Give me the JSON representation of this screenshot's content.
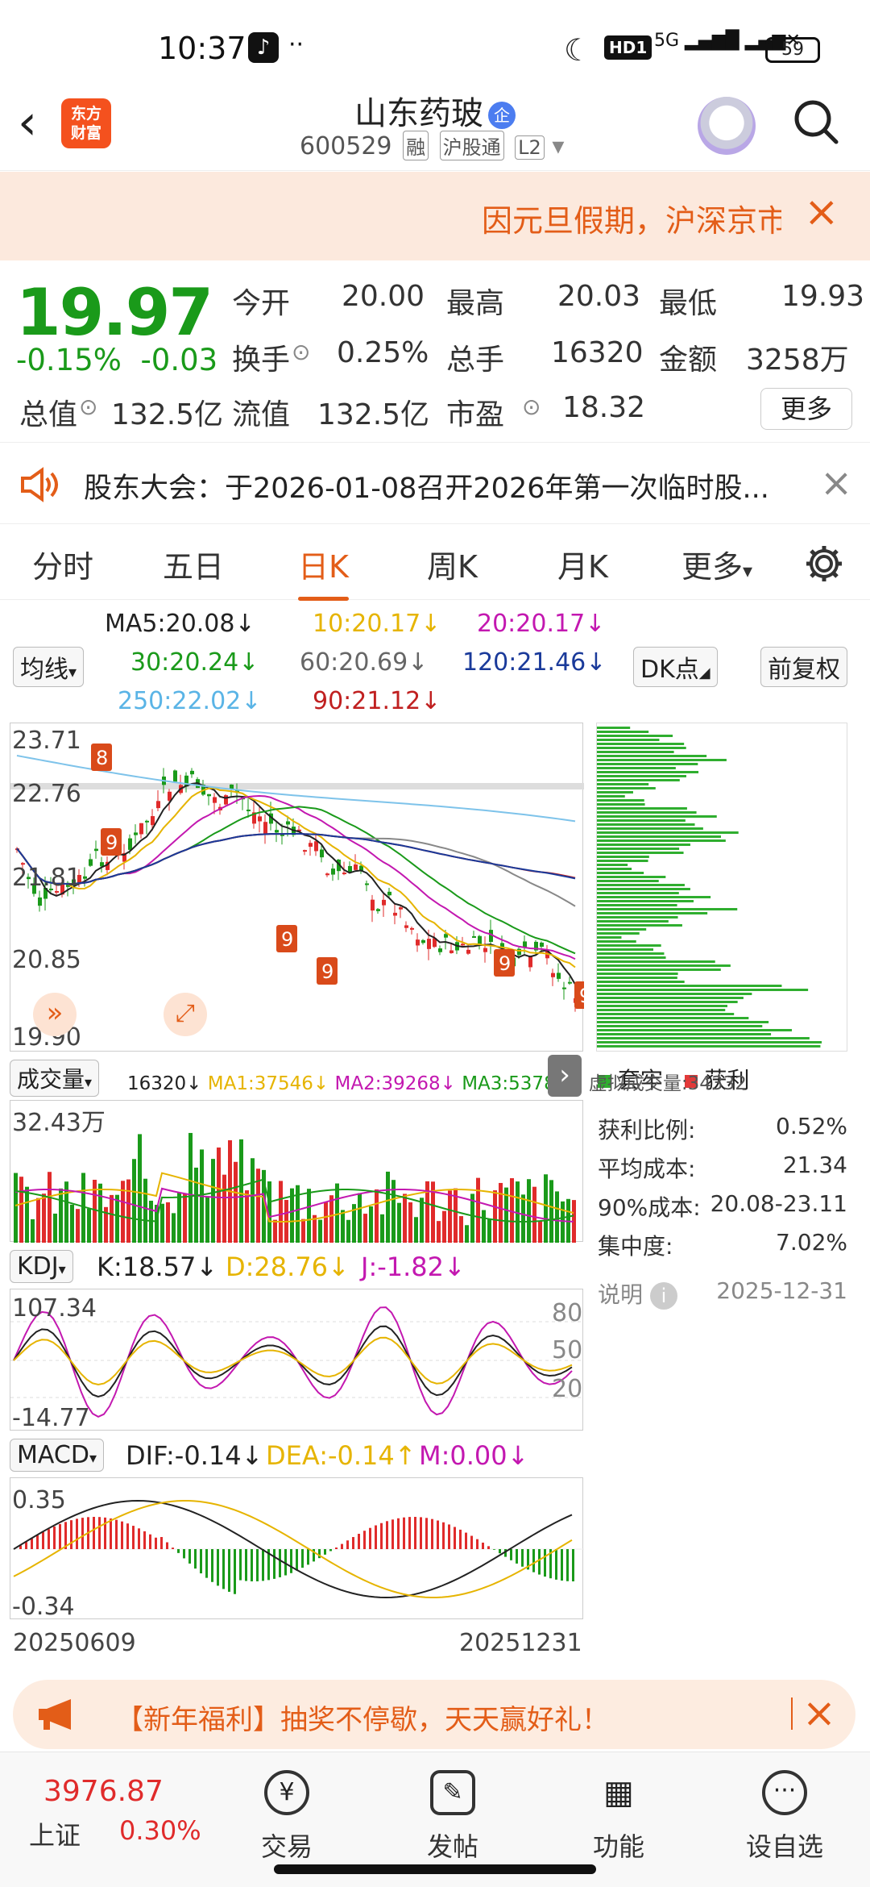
{
  "status_bar": {
    "time": "10:37",
    "network": "HD1",
    "signal": "5G",
    "battery": "59"
  },
  "header": {
    "logo_line1": "东方",
    "logo_line2": "财富",
    "stock_name": "山东药玻",
    "badge": "企",
    "code": "600529",
    "tags": [
      "融",
      "沪股通",
      "L2"
    ]
  },
  "notice": {
    "text": "因元旦假期，沪深京市"
  },
  "quote": {
    "price": "19.97",
    "change_pct": "-0.15%",
    "change": "-0.03",
    "fields": [
      {
        "label": "今开",
        "value": "20.00"
      },
      {
        "label": "最高",
        "value": "20.03"
      },
      {
        "label": "最低",
        "value": "19.93"
      },
      {
        "label": "换手",
        "value": "0.25%"
      },
      {
        "label": "总手",
        "value": "16320"
      },
      {
        "label": "金额",
        "value": "3258万"
      },
      {
        "label": "总值",
        "value": "132.5亿"
      },
      {
        "label": "流值",
        "value": "132.5亿"
      },
      {
        "label": "市盈",
        "value": "18.32"
      }
    ],
    "more_label": "更多"
  },
  "announcement": {
    "text": "股东大会：于2026-01-08召开2026年第一次临时股..."
  },
  "tabs": [
    "分时",
    "五日",
    "日K",
    "周K",
    "月K",
    "更多"
  ],
  "active_tab": "日K",
  "ma_legend": {
    "ma5": "MA5:20.08↓",
    "ma10": "10:20.17↓",
    "ma20": "20:20.17↓",
    "ma30": "30:20.24↓",
    "ma60": "60:20.69↓",
    "ma120": "120:21.46↓",
    "ma250": "250:22.02↓",
    "ma90": "90:21.12↓",
    "avg_btn": "均线",
    "dk_btn": "DK点",
    "fq_btn": "前复权"
  },
  "kline": {
    "y_labels": [
      "23.71",
      "22.76",
      "21.81",
      "20.85",
      "19.90"
    ],
    "watermark": "东方财富"
  },
  "volume": {
    "selector": "成交量",
    "vol": "16320↓",
    "ma1": "MA1:37546↓",
    "ma2": "MA2:39268↓",
    "ma3": "MA3:53781↓",
    "virtual": "虚拟成交量:34332",
    "top": "32.43万"
  },
  "kdj": {
    "selector": "KDJ",
    "k": "K:18.57↓",
    "d": "D:28.76↓",
    "j": "J:-1.82↓",
    "top": "107.34",
    "bottom": "-14.77",
    "l80": "80",
    "l50": "50",
    "l20": "20"
  },
  "macd": {
    "selector": "MACD",
    "dif": "DIF:-0.14↓",
    "dea": "DEA:-0.14↑",
    "m": "M:0.00↓",
    "top": "0.35",
    "bottom": "-0.34"
  },
  "x_axis": {
    "start": "20250609",
    "end": "20251231"
  },
  "chips": {
    "legend_trapped": "套牢",
    "legend_profit": "获利",
    "rows": [
      {
        "label": "获利比例:",
        "value": "0.52%"
      },
      {
        "label": "平均成本:",
        "value": "21.34"
      },
      {
        "label": "90%成本:",
        "value": "20.08-23.11"
      },
      {
        "label": "集中度:",
        "value": "7.02%"
      }
    ],
    "note_label": "说明",
    "date": "2025-12-31"
  },
  "promo": {
    "text": "【新年福利】抽奖不停歇，天天赢好礼！"
  },
  "bottom_nav": {
    "index_value": "3976.87",
    "index_name": "上证",
    "index_pct": "0.30%",
    "items": [
      "交易",
      "发帖",
      "功能",
      "设自选"
    ]
  },
  "colors": {
    "up": "#e02b2b",
    "down": "#1a9a1a",
    "accent": "#e35d18"
  }
}
